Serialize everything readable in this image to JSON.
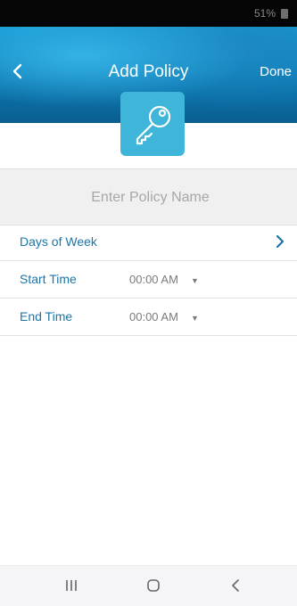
{
  "status_bar": {
    "battery_text": "51%"
  },
  "header": {
    "title": "Add Policy",
    "done_label": "Done",
    "back_icon": "chevron-left-icon",
    "policy_icon": "key-icon",
    "accent_color": "#3fb6d9"
  },
  "policy_name": {
    "value": "",
    "placeholder": "Enter Policy Name"
  },
  "rows": {
    "days_of_week": {
      "label": "Days of Week"
    },
    "start_time": {
      "label": "Start Time",
      "value": "00:00 AM"
    },
    "end_time": {
      "label": "End Time",
      "value": "00:00 AM"
    }
  },
  "nav": {
    "recents_icon": "recent-apps-icon",
    "home_icon": "home-icon",
    "back_icon": "back-chevron-icon"
  }
}
